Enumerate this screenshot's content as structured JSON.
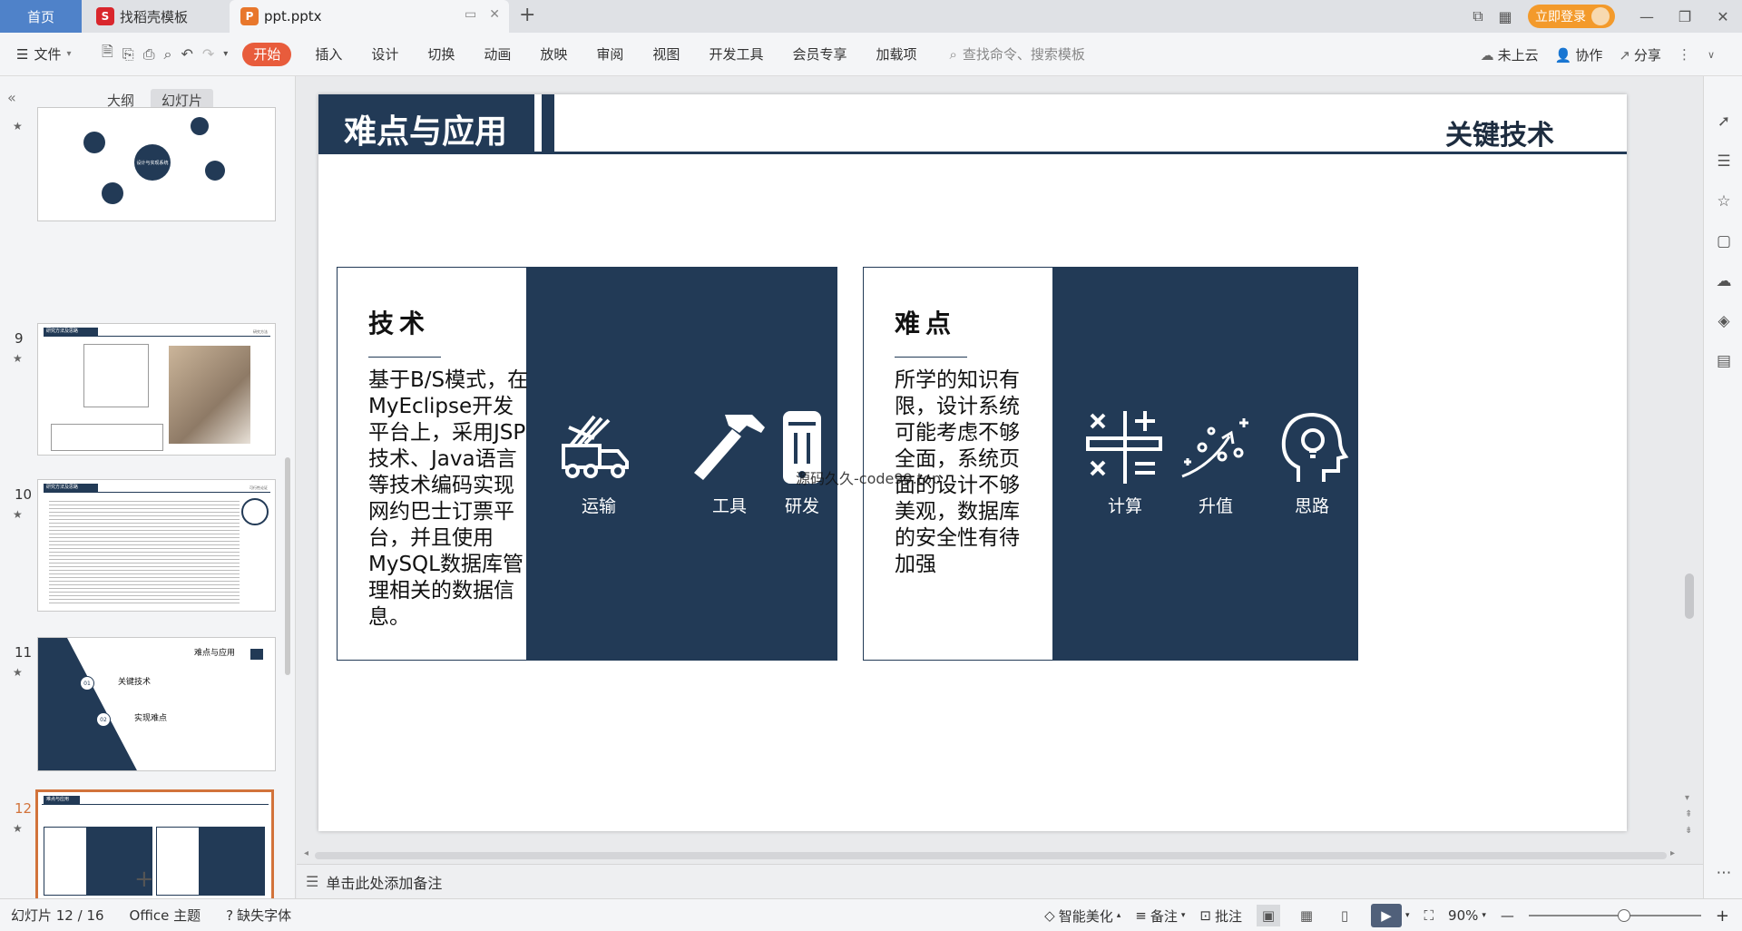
{
  "titlebar": {
    "home_tab": "首页",
    "template_tab": "找稻壳模板",
    "document_tab": "ppt.pptx",
    "login_button": "立即登录"
  },
  "ribbon": {
    "file_menu": "文件",
    "tabs": [
      "开始",
      "插入",
      "设计",
      "切换",
      "动画",
      "放映",
      "审阅",
      "视图",
      "开发工具",
      "会员专享",
      "加载项"
    ],
    "active_tab": "开始",
    "search_placeholder": "查找命令、搜索模板",
    "cloud_status": "未上云",
    "collaborate": "协作",
    "share": "分享"
  },
  "left_panel": {
    "tab_outline": "大纲",
    "tab_slides": "幻灯片",
    "active_tab": "幻灯片",
    "thumbnails": [
      {
        "number": "",
        "title": "设计与实现系统"
      },
      {
        "number": "9",
        "title": "研究方法及思路",
        "tag": "研究方法"
      },
      {
        "number": "10",
        "title": "研究方法及思路",
        "tag": "可行性论证"
      },
      {
        "number": "11",
        "title": "难点与应用",
        "item1_num": "01",
        "item1": "关键技术",
        "item2_num": "02",
        "item2": "实现难点"
      },
      {
        "number": "12",
        "title": "难点与应用",
        "selected": true
      }
    ]
  },
  "slide": {
    "title": "难点与应用",
    "subtitle": "关键技术",
    "card_left": {
      "heading": "技术",
      "body": "基于B/S模式，在MyEclipse开发平台上，采用JSP技术、Java语言等技术编码实现网约巴士订票平台，并且使用MySQL数据库管理相关的数据信息。",
      "icons": [
        {
          "name": "truck-icon",
          "label": "运输"
        },
        {
          "name": "hammer-icon",
          "label": "工具"
        },
        {
          "name": "phone-icon",
          "label": "研发"
        }
      ]
    },
    "card_right": {
      "heading": "难点",
      "body": "所学的知识有限，设计系统可能考虑不够全面，系统页面的设计不够美观，数据库的安全性有待加强",
      "icons": [
        {
          "name": "calculator-icon",
          "label": "计算"
        },
        {
          "name": "growth-icon",
          "label": "升值"
        },
        {
          "name": "head-bulb-icon",
          "label": "思路"
        }
      ]
    },
    "watermark": "源码久久-code99.top"
  },
  "notes_placeholder": "单击此处添加备注",
  "statusbar": {
    "slide_info": "幻灯片 12 / 16",
    "theme": "Office 主题",
    "missing_font": "缺失字体",
    "smart_beautify": "智能美化",
    "notes": "备注",
    "comments": "批注",
    "zoom": "90%"
  },
  "colors": {
    "slide_dark": "#223a56",
    "active_tab": "#e85c3c",
    "login": "#f39a2b",
    "home_tab": "#4f82c9",
    "selected_thumb": "#d2733b"
  }
}
